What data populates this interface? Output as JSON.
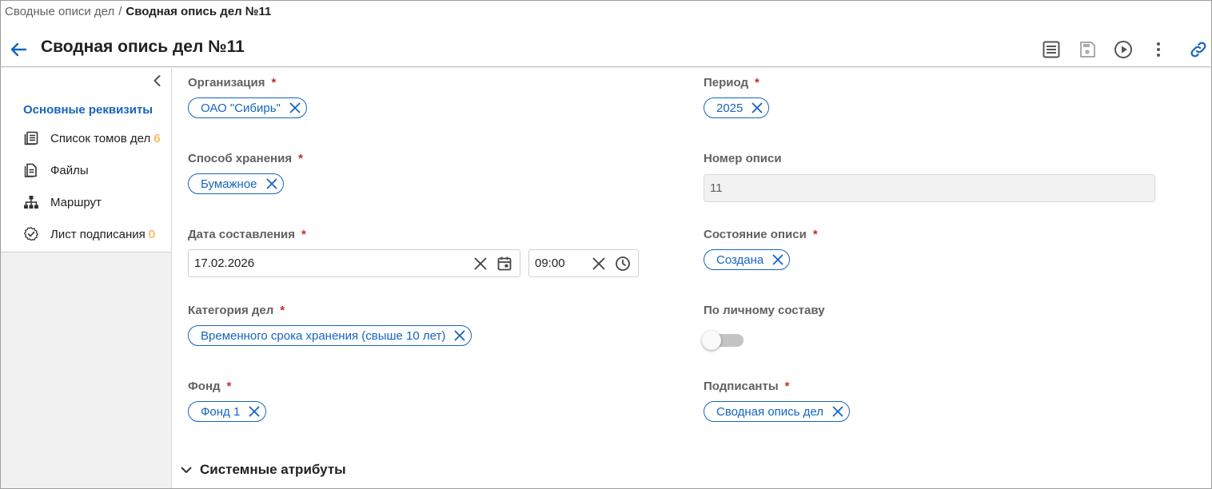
{
  "breadcrumb": {
    "parent": "Сводные описи дел",
    "separator": "/",
    "current": "Сводная опись дел №11"
  },
  "header": {
    "title": "Сводная опись дел №11",
    "icons": [
      "back-arrow-icon",
      "list-view-icon",
      "save-icon",
      "play-icon",
      "more-vert-icon",
      "link-icon"
    ]
  },
  "sidebar": {
    "items": [
      {
        "label": "Основные реквизиты",
        "icon": "",
        "count": ""
      },
      {
        "label": "Список томов дел",
        "icon": "volumes-list-icon",
        "count": "6"
      },
      {
        "label": "Файлы",
        "icon": "file-icon",
        "count": ""
      },
      {
        "label": "Маршрут",
        "icon": "route-tree-icon",
        "count": ""
      },
      {
        "label": "Лист подписания",
        "icon": "signature-badge-icon",
        "count": "0"
      }
    ]
  },
  "form": {
    "organization": {
      "label": "Организация",
      "required": "*",
      "value": "ОАО \"Сибирь\""
    },
    "period": {
      "label": "Период",
      "required": "*",
      "value": "2025"
    },
    "storage": {
      "label": "Способ хранения",
      "required": "*",
      "value": "Бумажное"
    },
    "number": {
      "label": "Номер описи",
      "value": "11"
    },
    "date": {
      "label": "Дата составления",
      "required": "*",
      "date_value": "17.02.2026",
      "time_value": "09:00"
    },
    "state": {
      "label": "Состояние описи",
      "required": "*",
      "value": "Создана"
    },
    "category": {
      "label": "Категория дел",
      "required": "*",
      "value": "Временного срока хранения (свыше 10 лет)"
    },
    "personnel": {
      "label": "По личному составу",
      "checked": false
    },
    "fund": {
      "label": "Фонд",
      "required": "*",
      "value": "Фонд 1"
    },
    "signers": {
      "label": "Подписанты",
      "required": "*",
      "value": "Сводная опись дел"
    }
  },
  "section": {
    "title": "Системные атрибуты"
  },
  "colors": {
    "accent": "#1565c0",
    "required": "#c62828",
    "count": "#f5a623"
  }
}
